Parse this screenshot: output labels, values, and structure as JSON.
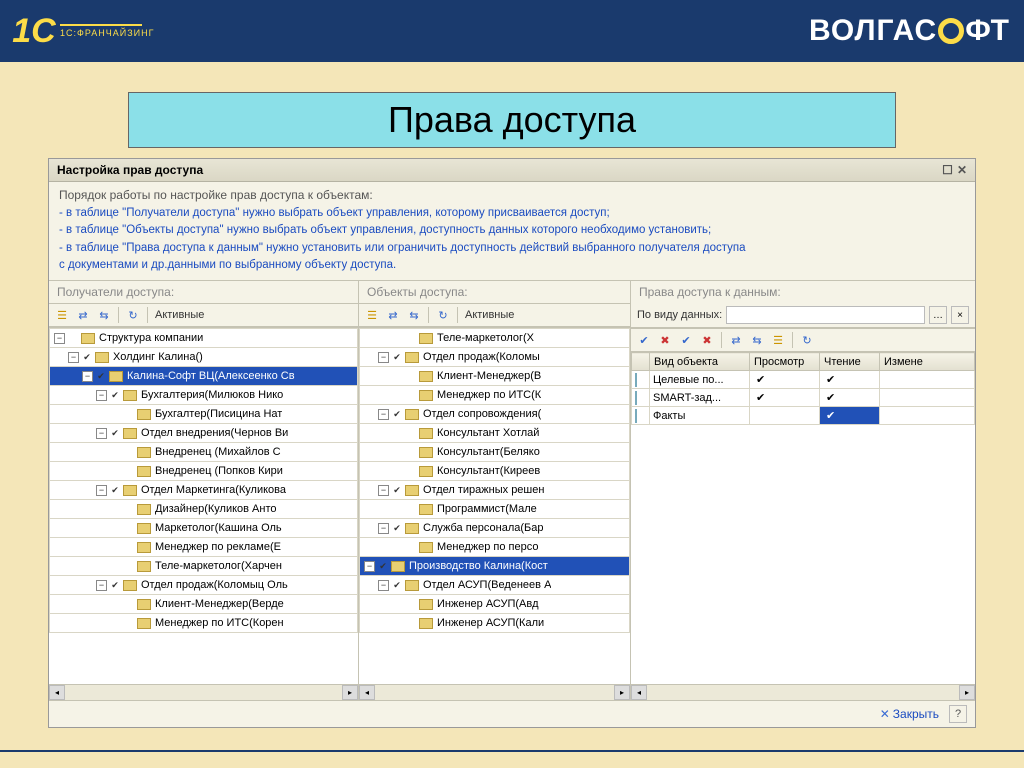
{
  "brand": {
    "franchising": "1C:ФРАНЧАЙЗИНГ",
    "volga": "ВОЛГАС",
    "volga2": "ФТ"
  },
  "slide_title": "Права доступа",
  "window_title": "Настройка прав доступа",
  "guide": {
    "head": "Порядок работы по настройке прав доступа к объектам:",
    "l1": "- в таблице \"Получатели доступа\" нужно выбрать объект управления, которому присваивается доступ;",
    "l2": "- в таблице \"Объекты доступа\" нужно выбрать объект управления, доступность данных которого необходимо установить;",
    "l3": "- в таблице \"Права доступа к данным\" нужно установить или ограничить доступность действий выбранного получателя доступа",
    "l4": "с документами и др.данными по выбранному объекту доступа."
  },
  "panel_a": {
    "title": "Получатели доступа:",
    "active": "Активные",
    "rows": [
      {
        "ind": 0,
        "exp": "−",
        "chk": "",
        "ic": "fold",
        "txt": "Структура компании"
      },
      {
        "ind": 1,
        "exp": "−",
        "chk": "✔",
        "ic": "fold",
        "txt": "Холдинг Калина()"
      },
      {
        "ind": 2,
        "exp": "−",
        "chk": "✔",
        "ic": "fold",
        "txt": "Калина-Софт ВЦ(Алексеенко Св",
        "sel": true
      },
      {
        "ind": 3,
        "exp": "−",
        "chk": "✔",
        "ic": "fold",
        "txt": "Бухгалтерия(Милюков Нико"
      },
      {
        "ind": 4,
        "exp": "",
        "chk": "",
        "ic": "fold",
        "txt": "Бухгалтер(Писицина Нат"
      },
      {
        "ind": 3,
        "exp": "−",
        "chk": "✔",
        "ic": "fold",
        "txt": "Отдел внедрения(Чернов Ви"
      },
      {
        "ind": 4,
        "exp": "",
        "chk": "",
        "ic": "fold",
        "txt": "Внедренец (Михайлов С"
      },
      {
        "ind": 4,
        "exp": "",
        "chk": "",
        "ic": "fold",
        "txt": "Внедренец (Попков Кири"
      },
      {
        "ind": 3,
        "exp": "−",
        "chk": "✔",
        "ic": "fold",
        "txt": "Отдел Маркетинга(Куликова"
      },
      {
        "ind": 4,
        "exp": "",
        "chk": "",
        "ic": "fold",
        "txt": "Дизайнер(Куликов Анто"
      },
      {
        "ind": 4,
        "exp": "",
        "chk": "",
        "ic": "fold",
        "txt": "Маркетолог(Кашина Оль"
      },
      {
        "ind": 4,
        "exp": "",
        "chk": "",
        "ic": "fold",
        "txt": "Менеджер по рекламе(Е"
      },
      {
        "ind": 4,
        "exp": "",
        "chk": "",
        "ic": "fold",
        "txt": "Теле-маркетолог(Харчен"
      },
      {
        "ind": 3,
        "exp": "−",
        "chk": "✔",
        "ic": "fold",
        "txt": "Отдел продаж(Коломыц Оль"
      },
      {
        "ind": 4,
        "exp": "",
        "chk": "",
        "ic": "fold",
        "txt": "Клиент-Менеджер(Верде"
      },
      {
        "ind": 4,
        "exp": "",
        "chk": "",
        "ic": "fold",
        "txt": "Менеджер по ИТС(Корен"
      }
    ]
  },
  "panel_b": {
    "title": "Объекты доступа:",
    "active": "Активные",
    "rows": [
      {
        "ind": 2,
        "exp": "",
        "chk": "",
        "ic": "fold",
        "txt": "Теле-маркетолог(Х"
      },
      {
        "ind": 1,
        "exp": "−",
        "chk": "✔",
        "ic": "fold",
        "txt": "Отдел продаж(Коломы"
      },
      {
        "ind": 2,
        "exp": "",
        "chk": "",
        "ic": "fold",
        "txt": "Клиент-Менеджер(В"
      },
      {
        "ind": 2,
        "exp": "",
        "chk": "",
        "ic": "fold",
        "txt": "Менеджер по ИТС(К"
      },
      {
        "ind": 1,
        "exp": "−",
        "chk": "✔",
        "ic": "fold",
        "txt": "Отдел сопровождения("
      },
      {
        "ind": 2,
        "exp": "",
        "chk": "",
        "ic": "fold",
        "txt": "Консультант Хотлай"
      },
      {
        "ind": 2,
        "exp": "",
        "chk": "",
        "ic": "fold",
        "txt": "Консультант(Беляко"
      },
      {
        "ind": 2,
        "exp": "",
        "chk": "",
        "ic": "fold",
        "txt": "Консультант(Киреев"
      },
      {
        "ind": 1,
        "exp": "−",
        "chk": "✔",
        "ic": "fold",
        "txt": "Отдел тиражных решен"
      },
      {
        "ind": 2,
        "exp": "",
        "chk": "",
        "ic": "fold",
        "txt": "Программист(Мале"
      },
      {
        "ind": 1,
        "exp": "−",
        "chk": "✔",
        "ic": "fold",
        "txt": "Служба персонала(Бар"
      },
      {
        "ind": 2,
        "exp": "",
        "chk": "",
        "ic": "fold",
        "txt": "Менеджер по персо"
      },
      {
        "ind": 0,
        "exp": "−",
        "chk": "✔",
        "ic": "fold",
        "txt": "Производство Калина(Кост",
        "sel": true
      },
      {
        "ind": 1,
        "exp": "−",
        "chk": "✔",
        "ic": "fold",
        "txt": "Отдел АСУП(Веденеев А"
      },
      {
        "ind": 2,
        "exp": "",
        "chk": "",
        "ic": "fold",
        "txt": "Инженер АСУП(Авд"
      },
      {
        "ind": 2,
        "exp": "",
        "chk": "",
        "ic": "fold",
        "txt": "Инженер АСУП(Кали"
      }
    ]
  },
  "panel_c": {
    "title": "Права доступа к данным:",
    "filter_label": "По виду данных:",
    "cols": [
      "Вид объекта",
      "Просмотр",
      "Чтение",
      "Измене"
    ],
    "rows": [
      {
        "name": "Целевые по...",
        "view": "✔",
        "read": "✔",
        "edit": ""
      },
      {
        "name": "SMART-зад...",
        "view": "✔",
        "read": "✔",
        "edit": ""
      },
      {
        "name": "Факты",
        "view": "",
        "read": "✔",
        "edit": "",
        "read_sel": true
      }
    ]
  },
  "footer": {
    "close": "Закрыть"
  }
}
